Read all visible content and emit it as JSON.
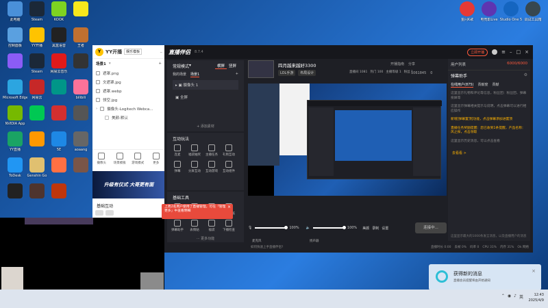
{
  "desktop_icons": [
    {
      "label": "此电脑",
      "color": "#4a90d9"
    },
    {
      "label": "Steam",
      "color": "#1b2838"
    },
    {
      "label": "KOOK",
      "color": "#7ed321"
    },
    {
      "label": "",
      "color": "#f8e71c"
    },
    {
      "label": "控制面板",
      "color": "#5aa0e0"
    },
    {
      "label": "YY开播",
      "color": "#ffc300"
    },
    {
      "label": "黑盒语音",
      "color": "#222"
    },
    {
      "label": "王者",
      "color": "#c07030"
    },
    {
      "label": "",
      "color": "#8b5cf6"
    },
    {
      "label": "Steam",
      "color": "#1b2838"
    },
    {
      "label": "网易云音乐",
      "color": "#e01a1a"
    },
    {
      "label": "",
      "color": "#333"
    },
    {
      "label": "Microsoft Edge",
      "color": "#2ca5e0"
    },
    {
      "label": "网易云",
      "color": "#c62828"
    },
    {
      "label": "",
      "color": "#009688"
    },
    {
      "label": "bilibili",
      "color": "#fb7299"
    },
    {
      "label": "NVIDIA App",
      "color": "#76b900"
    },
    {
      "label": "",
      "color": "#00c853"
    },
    {
      "label": "",
      "color": "#d32f2f"
    },
    {
      "label": "",
      "color": "#555"
    },
    {
      "label": "YY直播",
      "color": "#1aa364"
    },
    {
      "label": "",
      "color": "#ff9800"
    },
    {
      "label": "5E",
      "color": "#1e88e5"
    },
    {
      "label": "aoaang",
      "color": "#666"
    },
    {
      "label": "ToDesk",
      "color": "#2196f3"
    },
    {
      "label": "Genshin Go",
      "color": "#e0c070"
    },
    {
      "label": "",
      "color": "#ff7043"
    },
    {
      "label": "",
      "color": "#795548"
    },
    {
      "label": "",
      "color": "#222"
    },
    {
      "label": "",
      "color": "#4e342e"
    },
    {
      "label": "",
      "color": "#bf360c"
    }
  ],
  "right_icons": [
    {
      "label": "金闪K歌",
      "color": "#e53935"
    },
    {
      "label": "电竞影Live",
      "color": "#5e35b1"
    },
    {
      "label": "Studio One 5",
      "color": "#1565c0"
    },
    {
      "label": "调试工具箱",
      "color": "#37474f"
    }
  ],
  "yy": {
    "app_title": "YY开播",
    "mode": "娱乐模板",
    "scene": "场景1",
    "items": [
      "遮罩.png",
      "文遮罩.jpg",
      "遮罩.webp",
      "领空.jpg"
    ],
    "camera_item": "摄像头-Logitech Webca...",
    "sub_item": "美颜-默认",
    "tools": [
      "摄像头",
      "场景模板",
      "游戏模式",
      "更多"
    ],
    "banner": "升级有仪式 大哥更有面",
    "interaction": "基础互动"
  },
  "zb": {
    "title": "直播伴侣",
    "version": "8.7.4",
    "mode": "常规模式",
    "mode_tabs": [
      "横屏",
      "竖屏"
    ],
    "my_scene": "我的场景",
    "scene_tabs": [
      "场景1",
      "+"
    ],
    "sources": [
      "摄像头 1",
      "全屏"
    ],
    "add_source": "+ 添加素材",
    "interact_title": "互动玩法",
    "interact_tools": [
      "连麦",
      "福袋抽奖",
      "主播任务",
      "礼物互动",
      "弹幕",
      "分屏互动",
      "互动游戏",
      "互动组件"
    ],
    "basic_title": "基础工具",
    "basic_tools": [
      "美颜",
      "滤镜",
      "发起投票",
      "直播贴纸",
      "弹幕助手",
      "表情贴",
      "福袋",
      "下播检查"
    ],
    "more": "··· 更多功能",
    "live_title": "四月越来越好3300",
    "live_tags": [
      "LOL手游",
      "布局设计"
    ],
    "top_stats": [
      "开播指南",
      "分享"
    ],
    "room_stats": [
      "直播间 1081",
      "热门 100",
      "主播等级 1",
      "粉丝 1"
    ],
    "viewer_stats": [
      "1061845",
      "0"
    ],
    "go_live_badge": "立即开播",
    "mic_label": "麦克风",
    "mic_value": "100%",
    "mic_level": 1.0,
    "speaker_label": "扬声器",
    "speaker_value": "100%",
    "speaker_level": 1.0,
    "ctrl_labels": [
      "美颜",
      "录制",
      "设置"
    ],
    "start_button": "连接中...",
    "status": "如何快速上手直播伴侣?",
    "status_right": [
      "直播时长 0:00",
      "丢帧 0%",
      "码率 0",
      "CPU 31%",
      "内存 31%",
      "Ok 网络"
    ],
    "toast": "上周2名用户使用了直播管理，可在「管理更多」中查看明细",
    "user_list_title": "用户列表",
    "user_count": "6000/6000",
    "chat_title": "弹幕助手",
    "chat_tabs": [
      "在线用户(875)",
      "贡献度",
      "贡献"
    ],
    "chat_msgs": [
      "这里显示礼物和评论等信息，粉丝团：粉丝团、弹幕投屏等",
      "这里显示弹幕相关提示与说明，点击弹幕可以进行相应操作",
      "新增[弹幕置顶]功能，点击弹幕添加进置顶",
      "直播任务奖励提醒：您已收到1条提醒，产品名称：风之探，点击领取",
      "这里显示历史消息，可以点击查看"
    ],
    "chat_link": "去看看 >",
    "chat_input": "这里显示最大的1000条发言消息，以及直播用户的消息"
  },
  "notification": {
    "title": "获得新的消息",
    "body": "直播会员提醒将由开始通知"
  },
  "taskbar": {
    "time": "12:43",
    "date": "2025/4/9",
    "lang": "英"
  }
}
